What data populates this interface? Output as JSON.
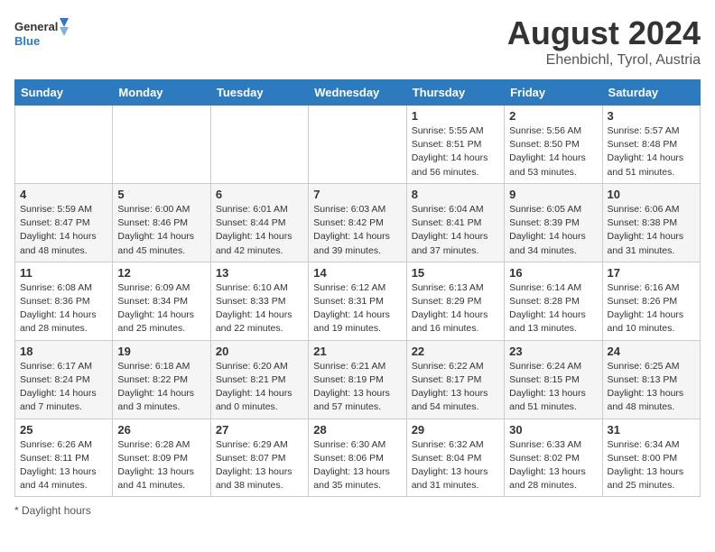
{
  "header": {
    "logo_line1": "General",
    "logo_line2": "Blue",
    "month_year": "August 2024",
    "location": "Ehenbichl, Tyrol, Austria"
  },
  "days_of_week": [
    "Sunday",
    "Monday",
    "Tuesday",
    "Wednesday",
    "Thursday",
    "Friday",
    "Saturday"
  ],
  "footer": {
    "daylight_label": "Daylight hours"
  },
  "weeks": [
    {
      "days": [
        {
          "num": "",
          "info": ""
        },
        {
          "num": "",
          "info": ""
        },
        {
          "num": "",
          "info": ""
        },
        {
          "num": "",
          "info": ""
        },
        {
          "num": "1",
          "info": "Sunrise: 5:55 AM\nSunset: 8:51 PM\nDaylight: 14 hours\nand 56 minutes."
        },
        {
          "num": "2",
          "info": "Sunrise: 5:56 AM\nSunset: 8:50 PM\nDaylight: 14 hours\nand 53 minutes."
        },
        {
          "num": "3",
          "info": "Sunrise: 5:57 AM\nSunset: 8:48 PM\nDaylight: 14 hours\nand 51 minutes."
        }
      ]
    },
    {
      "days": [
        {
          "num": "4",
          "info": "Sunrise: 5:59 AM\nSunset: 8:47 PM\nDaylight: 14 hours\nand 48 minutes."
        },
        {
          "num": "5",
          "info": "Sunrise: 6:00 AM\nSunset: 8:46 PM\nDaylight: 14 hours\nand 45 minutes."
        },
        {
          "num": "6",
          "info": "Sunrise: 6:01 AM\nSunset: 8:44 PM\nDaylight: 14 hours\nand 42 minutes."
        },
        {
          "num": "7",
          "info": "Sunrise: 6:03 AM\nSunset: 8:42 PM\nDaylight: 14 hours\nand 39 minutes."
        },
        {
          "num": "8",
          "info": "Sunrise: 6:04 AM\nSunset: 8:41 PM\nDaylight: 14 hours\nand 37 minutes."
        },
        {
          "num": "9",
          "info": "Sunrise: 6:05 AM\nSunset: 8:39 PM\nDaylight: 14 hours\nand 34 minutes."
        },
        {
          "num": "10",
          "info": "Sunrise: 6:06 AM\nSunset: 8:38 PM\nDaylight: 14 hours\nand 31 minutes."
        }
      ]
    },
    {
      "days": [
        {
          "num": "11",
          "info": "Sunrise: 6:08 AM\nSunset: 8:36 PM\nDaylight: 14 hours\nand 28 minutes."
        },
        {
          "num": "12",
          "info": "Sunrise: 6:09 AM\nSunset: 8:34 PM\nDaylight: 14 hours\nand 25 minutes."
        },
        {
          "num": "13",
          "info": "Sunrise: 6:10 AM\nSunset: 8:33 PM\nDaylight: 14 hours\nand 22 minutes."
        },
        {
          "num": "14",
          "info": "Sunrise: 6:12 AM\nSunset: 8:31 PM\nDaylight: 14 hours\nand 19 minutes."
        },
        {
          "num": "15",
          "info": "Sunrise: 6:13 AM\nSunset: 8:29 PM\nDaylight: 14 hours\nand 16 minutes."
        },
        {
          "num": "16",
          "info": "Sunrise: 6:14 AM\nSunset: 8:28 PM\nDaylight: 14 hours\nand 13 minutes."
        },
        {
          "num": "17",
          "info": "Sunrise: 6:16 AM\nSunset: 8:26 PM\nDaylight: 14 hours\nand 10 minutes."
        }
      ]
    },
    {
      "days": [
        {
          "num": "18",
          "info": "Sunrise: 6:17 AM\nSunset: 8:24 PM\nDaylight: 14 hours\nand 7 minutes."
        },
        {
          "num": "19",
          "info": "Sunrise: 6:18 AM\nSunset: 8:22 PM\nDaylight: 14 hours\nand 3 minutes."
        },
        {
          "num": "20",
          "info": "Sunrise: 6:20 AM\nSunset: 8:21 PM\nDaylight: 14 hours\nand 0 minutes."
        },
        {
          "num": "21",
          "info": "Sunrise: 6:21 AM\nSunset: 8:19 PM\nDaylight: 13 hours\nand 57 minutes."
        },
        {
          "num": "22",
          "info": "Sunrise: 6:22 AM\nSunset: 8:17 PM\nDaylight: 13 hours\nand 54 minutes."
        },
        {
          "num": "23",
          "info": "Sunrise: 6:24 AM\nSunset: 8:15 PM\nDaylight: 13 hours\nand 51 minutes."
        },
        {
          "num": "24",
          "info": "Sunrise: 6:25 AM\nSunset: 8:13 PM\nDaylight: 13 hours\nand 48 minutes."
        }
      ]
    },
    {
      "days": [
        {
          "num": "25",
          "info": "Sunrise: 6:26 AM\nSunset: 8:11 PM\nDaylight: 13 hours\nand 44 minutes."
        },
        {
          "num": "26",
          "info": "Sunrise: 6:28 AM\nSunset: 8:09 PM\nDaylight: 13 hours\nand 41 minutes."
        },
        {
          "num": "27",
          "info": "Sunrise: 6:29 AM\nSunset: 8:07 PM\nDaylight: 13 hours\nand 38 minutes."
        },
        {
          "num": "28",
          "info": "Sunrise: 6:30 AM\nSunset: 8:06 PM\nDaylight: 13 hours\nand 35 minutes."
        },
        {
          "num": "29",
          "info": "Sunrise: 6:32 AM\nSunset: 8:04 PM\nDaylight: 13 hours\nand 31 minutes."
        },
        {
          "num": "30",
          "info": "Sunrise: 6:33 AM\nSunset: 8:02 PM\nDaylight: 13 hours\nand 28 minutes."
        },
        {
          "num": "31",
          "info": "Sunrise: 6:34 AM\nSunset: 8:00 PM\nDaylight: 13 hours\nand 25 minutes."
        }
      ]
    }
  ]
}
